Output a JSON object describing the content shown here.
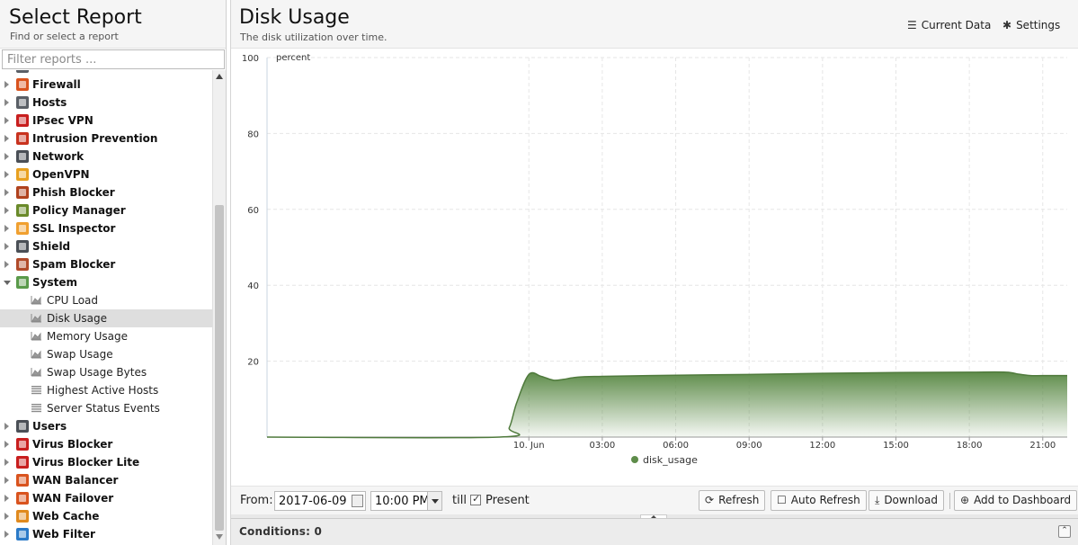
{
  "sidebar": {
    "title": "Select Report",
    "subtitle": "Find or select a report",
    "filter_placeholder": "Filter reports ...",
    "items": [
      {
        "type": "app",
        "label": "Firewall",
        "color": "#d9531e",
        "expanded": false
      },
      {
        "type": "app",
        "label": "Hosts",
        "color": "#5a5f66",
        "expanded": false
      },
      {
        "type": "app",
        "label": "IPsec VPN",
        "color": "#c81e1e",
        "expanded": false
      },
      {
        "type": "app",
        "label": "Intrusion Prevention",
        "color": "#c8321e",
        "expanded": false
      },
      {
        "type": "app",
        "label": "Network",
        "color": "#4a4f56",
        "expanded": false
      },
      {
        "type": "app",
        "label": "OpenVPN",
        "color": "#e8a020",
        "expanded": false
      },
      {
        "type": "app",
        "label": "Phish Blocker",
        "color": "#b0421e",
        "expanded": false
      },
      {
        "type": "app",
        "label": "Policy Manager",
        "color": "#6a8a2a",
        "expanded": false
      },
      {
        "type": "app",
        "label": "SSL Inspector",
        "color": "#f0a030",
        "expanded": false
      },
      {
        "type": "app",
        "label": "Shield",
        "color": "#4a4f56",
        "expanded": false
      },
      {
        "type": "app",
        "label": "Spam Blocker",
        "color": "#b04a2a",
        "expanded": false
      },
      {
        "type": "app",
        "label": "System",
        "color": "#5a9a4a",
        "expanded": true
      },
      {
        "type": "report",
        "label": "CPU Load",
        "icon": "area-chart-icon"
      },
      {
        "type": "report",
        "label": "Disk Usage",
        "icon": "area-chart-icon",
        "selected": true
      },
      {
        "type": "report",
        "label": "Memory Usage",
        "icon": "area-chart-icon"
      },
      {
        "type": "report",
        "label": "Swap Usage",
        "icon": "area-chart-icon"
      },
      {
        "type": "report",
        "label": "Swap Usage Bytes",
        "icon": "area-chart-icon"
      },
      {
        "type": "report",
        "label": "Highest Active Hosts",
        "icon": "list-icon"
      },
      {
        "type": "report",
        "label": "Server Status Events",
        "icon": "list-icon"
      },
      {
        "type": "app",
        "label": "Users",
        "color": "#4a4f56",
        "expanded": false
      },
      {
        "type": "app",
        "label": "Virus Blocker",
        "color": "#c81e1e",
        "expanded": false
      },
      {
        "type": "app",
        "label": "Virus Blocker Lite",
        "color": "#c81e1e",
        "expanded": false
      },
      {
        "type": "app",
        "label": "WAN Balancer",
        "color": "#d9531e",
        "expanded": false
      },
      {
        "type": "app",
        "label": "WAN Failover",
        "color": "#d9531e",
        "expanded": false
      },
      {
        "type": "app",
        "label": "Web Cache",
        "color": "#e08a1e",
        "expanded": false
      },
      {
        "type": "app",
        "label": "Web Filter",
        "color": "#2a7ac8",
        "expanded": false
      }
    ]
  },
  "report": {
    "title": "Disk Usage",
    "subtitle": "The disk utilization over time.",
    "current_data_label": "Current Data",
    "settings_label": "Settings"
  },
  "toolbar": {
    "from_label": "From:",
    "date_value": "2017-06-09",
    "time_value": "10:00 PM",
    "till_label": "till",
    "present_label": "Present",
    "present_checked": true,
    "refresh_label": "Refresh",
    "auto_refresh_label": "Auto Refresh",
    "download_label": "Download",
    "add_dashboard_label": "Add to Dashboard"
  },
  "conditions": {
    "label": "Conditions: 0"
  },
  "chart_data": {
    "type": "area",
    "title": "",
    "ylabel": "percent",
    "xlabel": "",
    "ylim": [
      0,
      100
    ],
    "yticks": [
      20,
      40,
      60,
      80,
      100
    ],
    "xlim_hours": [
      -10.7,
      22.0
    ],
    "xticks": [
      {
        "label": "10. Jun",
        "hour": 0
      },
      {
        "label": "03:00",
        "hour": 3
      },
      {
        "label": "06:00",
        "hour": 6
      },
      {
        "label": "09:00",
        "hour": 9
      },
      {
        "label": "12:00",
        "hour": 12
      },
      {
        "label": "15:00",
        "hour": 15
      },
      {
        "label": "18:00",
        "hour": 18
      },
      {
        "label": "21:00",
        "hour": 21
      }
    ],
    "series": [
      {
        "name": "disk_usage",
        "color": "#5e8c4a",
        "hours": [
          -10.7,
          -1.2,
          -0.8,
          -0.5,
          0.0,
          0.5,
          1.0,
          1.4,
          2.0,
          3.0,
          6.0,
          9.0,
          12.0,
          15.0,
          18.0,
          19.5,
          20.0,
          20.5,
          21.0,
          22.0
        ],
        "values": [
          0.0,
          0.0,
          2.5,
          9.0,
          16.5,
          16.0,
          15.0,
          15.2,
          15.8,
          16.0,
          16.3,
          16.5,
          16.8,
          17.0,
          17.1,
          17.1,
          16.6,
          16.2,
          16.2,
          16.2
        ]
      }
    ],
    "legend": "bottom-center",
    "grid": true
  }
}
